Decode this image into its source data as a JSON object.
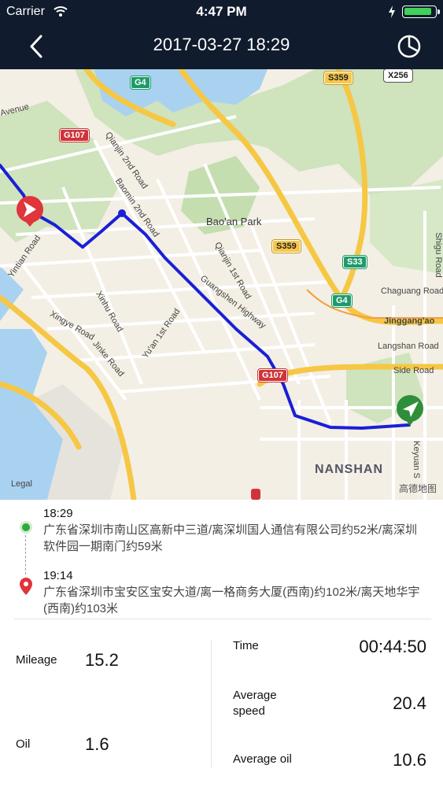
{
  "status": {
    "carrier": "Carrier",
    "time": "4:47 PM"
  },
  "nav": {
    "title": "2017-03-27 18:29"
  },
  "map": {
    "shields": {
      "g4_top": "G4",
      "g107_left": "G107",
      "s359_top": "S359",
      "x256": "X256",
      "s359_mid": "S359",
      "s33": "S33",
      "g4_right": "G4",
      "g107_mid": "G107"
    },
    "roads": {
      "avenue": "Avenue",
      "qianjin2": "Qianjin 2nd Road",
      "baomin2": "Baomin 2nd Road",
      "yintian": "Yintian Road",
      "xinhu": "Xinhu Road",
      "xingye": "Xingye Road",
      "jinke": "Jinke Road",
      "yuan1": "Yu'an 1st Road",
      "qianjin1": "Qianjin 1st Road",
      "guangshen": "Guangshen Highway",
      "shigu": "Shigu Road",
      "chaguang": "Chaguang Road",
      "jinggang": "Jinggang'ao",
      "langshan": "Langshan Road",
      "side": "Side Road",
      "keyuan": "Keyuan S",
      "baoan_park": "Bao'an Park"
    },
    "district": "NANSHAN",
    "legal": "Legal",
    "logo": "高德地图"
  },
  "trip": {
    "start": {
      "time": "18:29",
      "address": "广东省深圳市南山区高新中三道/离深圳国人通信有限公司约52米/离深圳软件园一期南门约59米"
    },
    "end": {
      "time": "19:14",
      "address": "广东省深圳市宝安区宝安大道/离一格商务大厦(西南)约102米/离天地华宇(西南)约103米"
    }
  },
  "stats": {
    "mileage_label": "Mileage",
    "mileage_value": "15.2",
    "oil_label": "Oil",
    "oil_value": "1.6",
    "time_label": "Time",
    "time_value": "00:44:50",
    "avg_speed_label": "Average speed",
    "avg_speed_value": "20.4",
    "avg_oil_label": "Average oil",
    "avg_oil_value": "10.6"
  },
  "colors": {
    "nav_bg": "#101b2d",
    "route": "#1a1fd6",
    "start_green": "#2daa3b",
    "end_red": "#e0353b",
    "battery": "#3fd15a"
  }
}
